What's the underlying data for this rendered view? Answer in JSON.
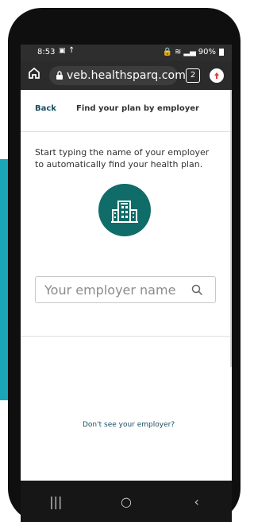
{
  "status_bar": {
    "time": "8:53",
    "icons_left": [
      "image-icon",
      "upload-icon"
    ],
    "icons_right": [
      "lock-icon",
      "wifi-icon",
      "signal-icon",
      "battery-icon"
    ],
    "battery": "90%"
  },
  "browser": {
    "url_display": "veb.healthsparq.com",
    "tab_count": "2"
  },
  "page": {
    "back_label": "Back",
    "title": "Find your plan by employer",
    "intro": "Start typing the name of your employer to automatically find your health plan.",
    "search_placeholder": "Your employer name",
    "missing_employer_link": "Don't see your employer?"
  },
  "navigation": {
    "recent_apps": "|||",
    "home": "○",
    "back": "‹"
  },
  "colors": {
    "teal_accent": "#1aa6b6",
    "brand_dark": "#184d63",
    "employer_icon_bg": "#0f6c68"
  }
}
